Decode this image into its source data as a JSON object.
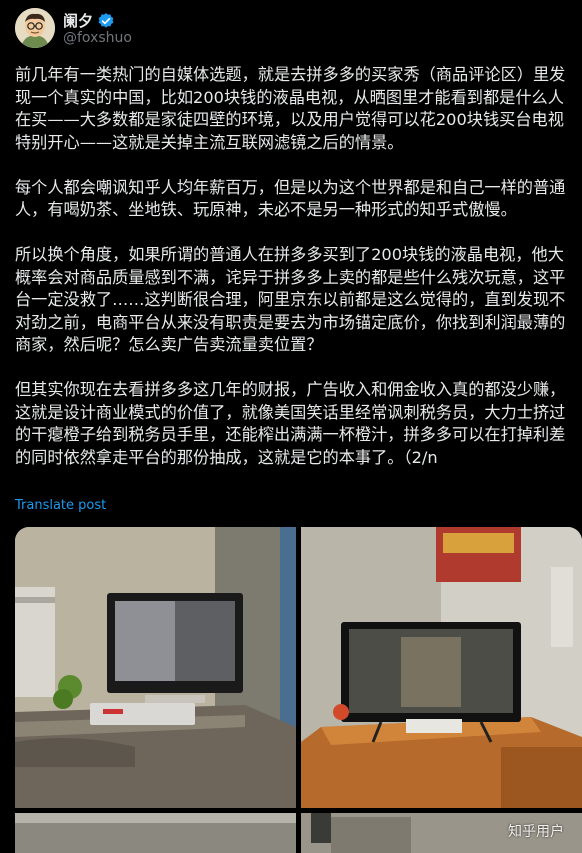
{
  "author": {
    "display_name": "阑夕",
    "handle": "@foxshuo",
    "avatar_icon": "cartoon-avatar-icon",
    "verified_icon": "verified-badge-icon",
    "verified_color": "#1d9bf0"
  },
  "post": {
    "paragraphs": [
      "前几年有一类热门的自媒体选题，就是去拼多多的买家秀（商品评论区）里发现一个真实的中国，比如200块钱的液晶电视，从晒图里才能看到都是什么人在买——大多数都是家徒四壁的环境，以及用户觉得可以花200块钱买台电视特别开心——这就是关掉主流互联网滤镜之后的情景。",
      "每个人都会嘲讽知乎人均年薪百万，但是以为这个世界都是和自己一样的普通人，有喝奶茶、坐地铁、玩原神，未必不是另一种形式的知乎式傲慢。",
      "所以换个角度，如果所谓的普通人在拼多多买到了200块钱的液晶电视，他大概率会对商品质量感到不满，诧异于拼多多上卖的都是些什么残次玩意，这平台一定没救了……这判断很合理，阿里京东以前都是这么觉得的，直到发现不对劲之前，电商平台从来没有职责是要去为市场锚定底价，你找到利润最薄的商家，然后呢？怎么卖广告卖流量卖位置？",
      "但其实你现在去看拼多多这几年的财报，广告收入和佣金收入真的都没少赚，这就是设计商业模式的价值了，就像美国笑话里经常讽刺税务员，大力士挤过的干瘪橙子给到税务员手里，还能榨出满满一杯橙汁，拼多多可以在打掉利差的同时依然拿走平台的那份抽成，这就是它的本事了。（2/n"
    ],
    "translate_label": "Translate post",
    "link_color": "#1d9bf0"
  },
  "media": {
    "watermark": "知乎用户",
    "photos": [
      "tv-photo-1",
      "tv-photo-2",
      "tv-photo-3",
      "tv-photo-4"
    ]
  }
}
